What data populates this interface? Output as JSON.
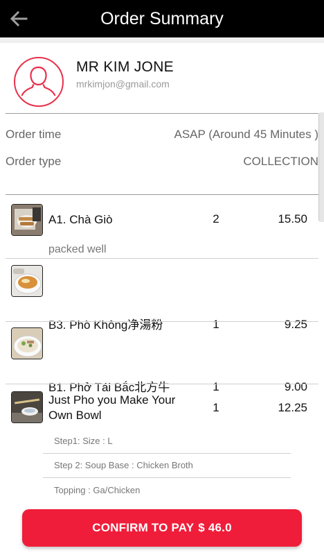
{
  "header": {
    "title": "Order Summary",
    "back_icon": "arrow-left-icon"
  },
  "customer": {
    "name": "MR KIM JONE",
    "email": "mrkimjon@gmail.com",
    "avatar_icon": "user-avatar-icon"
  },
  "order_info": [
    {
      "label": "Order time",
      "value": "ASAP (Around 45 Minutes )"
    },
    {
      "label": "Order type",
      "value": "COLLECTION"
    }
  ],
  "items": [
    {
      "name": "A1. Chà Giò",
      "qty": "2",
      "price": "15.50",
      "note": "packed well"
    },
    {
      "name": "B3. Phò Không净湯粉",
      "qty": "1",
      "price": "9.25"
    },
    {
      "name": "B1. Phở Tái Bắc北方牛",
      "qty": "1",
      "price": "9.00"
    },
    {
      "name": "Just Pho you Make Your Own Bowl",
      "qty": "1",
      "price": "12.25",
      "options": [
        "Step1: Size  :  L",
        "Step 2: Soup Base   :  Chicken Broth",
        "Topping  :  Ga/Chicken"
      ]
    }
  ],
  "pay_button": {
    "label": "CONFIRM TO PAY",
    "amount": "$ 46.0"
  },
  "colors": {
    "accent": "#ef1d3a",
    "header_bg": "#000000",
    "avatar_ring": "#e8304a"
  }
}
